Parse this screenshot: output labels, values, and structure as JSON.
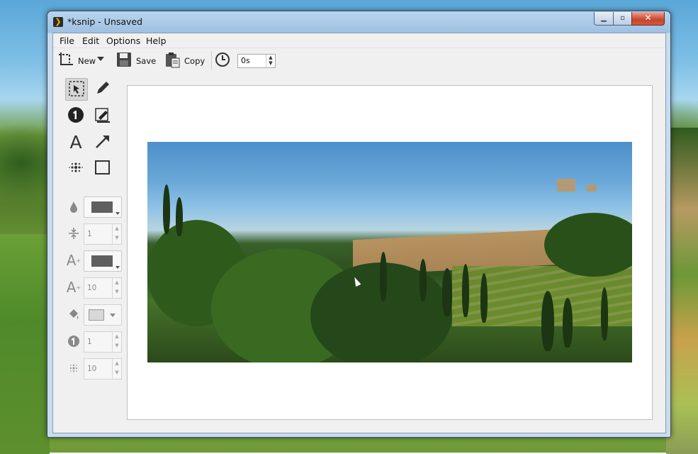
{
  "window": {
    "title": "*ksnip - Unsaved",
    "app_icon": "ksnip-icon"
  },
  "window_controls": {
    "minimize": "minimize-icon",
    "maximize": "maximize-icon",
    "close": "close-icon"
  },
  "menu": {
    "file": "File",
    "edit": "Edit",
    "options": "Options",
    "help": "Help"
  },
  "toolbar": {
    "new_label": "New",
    "save_label": "Save",
    "copy_label": "Copy",
    "delay_value": "0s"
  },
  "tools": [
    {
      "name": "select",
      "icon": "select-icon",
      "active": true
    },
    {
      "name": "pen",
      "icon": "pen-icon"
    },
    {
      "name": "number",
      "icon": "number-icon"
    },
    {
      "name": "marker",
      "icon": "marker-icon"
    },
    {
      "name": "text",
      "icon": "text-icon"
    },
    {
      "name": "arrow",
      "icon": "arrow-icon"
    },
    {
      "name": "blur",
      "icon": "blur-icon"
    },
    {
      "name": "rectangle",
      "icon": "rectangle-icon"
    }
  ],
  "properties": {
    "color_value": "#5f5f5f",
    "width_value": "1",
    "text_color_value": "#5f5f5f",
    "font_size_value": "10",
    "fill_value": "#d8d8d8",
    "number_size_value": "1",
    "blur_radius_value": "10"
  }
}
